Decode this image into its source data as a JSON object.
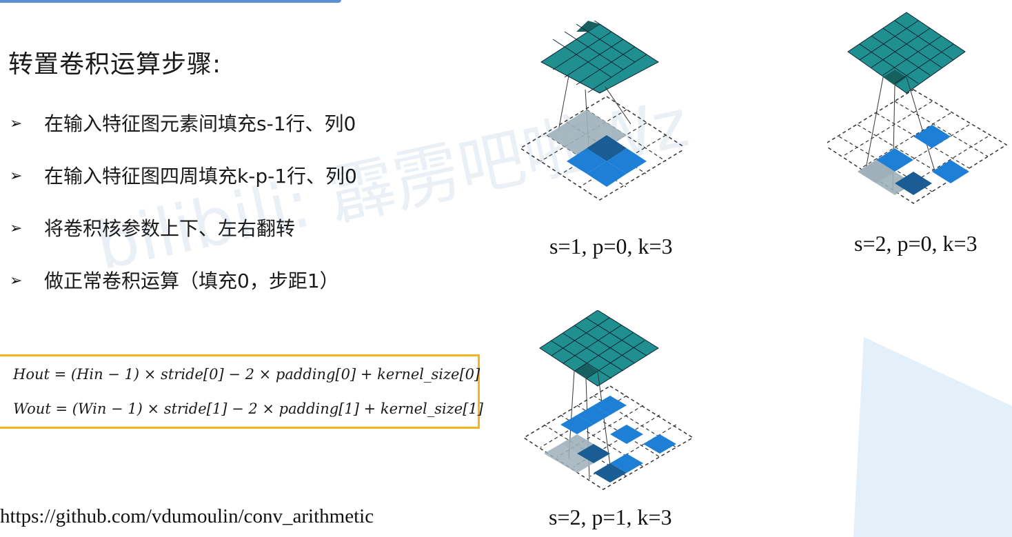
{
  "title": "转置卷积运算步骤:",
  "steps": [
    "在输入特征图元素间填充s-1行、列0",
    "在输入特征图四周填充k-p-1行、列0",
    "将卷积核参数上下、左右翻转",
    "做正常卷积运算（填充0，步距1）"
  ],
  "bullet_glyph": "➢",
  "formulas": {
    "h_out": "Hout = (Hin − 1) × stride[0] − 2 × padding[0] + kernel_size[0]",
    "w_out": "Wout = (Win − 1) × stride[1] − 2 × padding[1] + kernel_size[1]"
  },
  "url": "https://github.com/vdumoulin/conv_arithmetic",
  "diagrams": [
    {
      "caption": "s=1, p=0, k=3"
    },
    {
      "caption": "s=2, p=0, k=3"
    },
    {
      "caption": "s=2, p=1, k=3"
    }
  ],
  "watermark": "bilibili: 霹雳吧啦Wz",
  "colors": {
    "output_grid": "#1f8f8f",
    "output_grid_dark": "#16605f",
    "input_blue": "#1e7fd6",
    "input_dark": "#1a5d94",
    "kernel_gray": "#9fb0ba",
    "formula_border": "#f2b520",
    "accent_bar": "#5b8fd0"
  }
}
